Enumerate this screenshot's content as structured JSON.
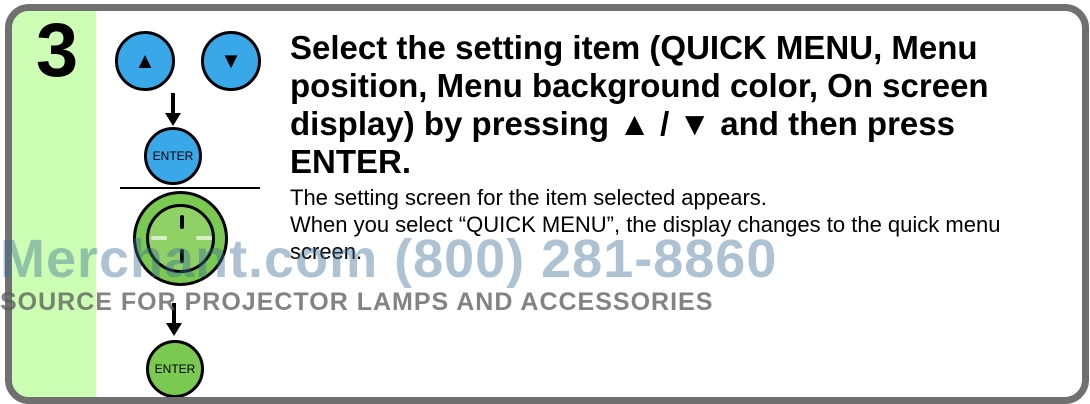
{
  "step": {
    "number": "3"
  },
  "buttons": {
    "up_icon": "▲",
    "down_icon": "▼",
    "enter_label": "ENTER"
  },
  "instruction": {
    "heading": "Select the setting item (QUICK MENU, Menu position, Menu background color, On screen display) by pressing ▲ / ▼ and then press ENTER.",
    "line1": "The setting screen for the item selected appears.",
    "line2": "When you select “QUICK MENU”, the display changes to the quick menu screen."
  },
  "watermark": {
    "line1": "Merchant.com (800) 281-8860",
    "line2": "SOURCE FOR PROJECTOR LAMPS AND ACCESSORIES"
  },
  "colors": {
    "frame": "#707070",
    "step_column": "#ccffb3",
    "blue_button": "#38a8e8",
    "green_button": "#7ac950"
  },
  "icons": [
    "up-arrow-icon",
    "down-arrow-icon",
    "joystick-icon",
    "arrow-down-icon"
  ]
}
